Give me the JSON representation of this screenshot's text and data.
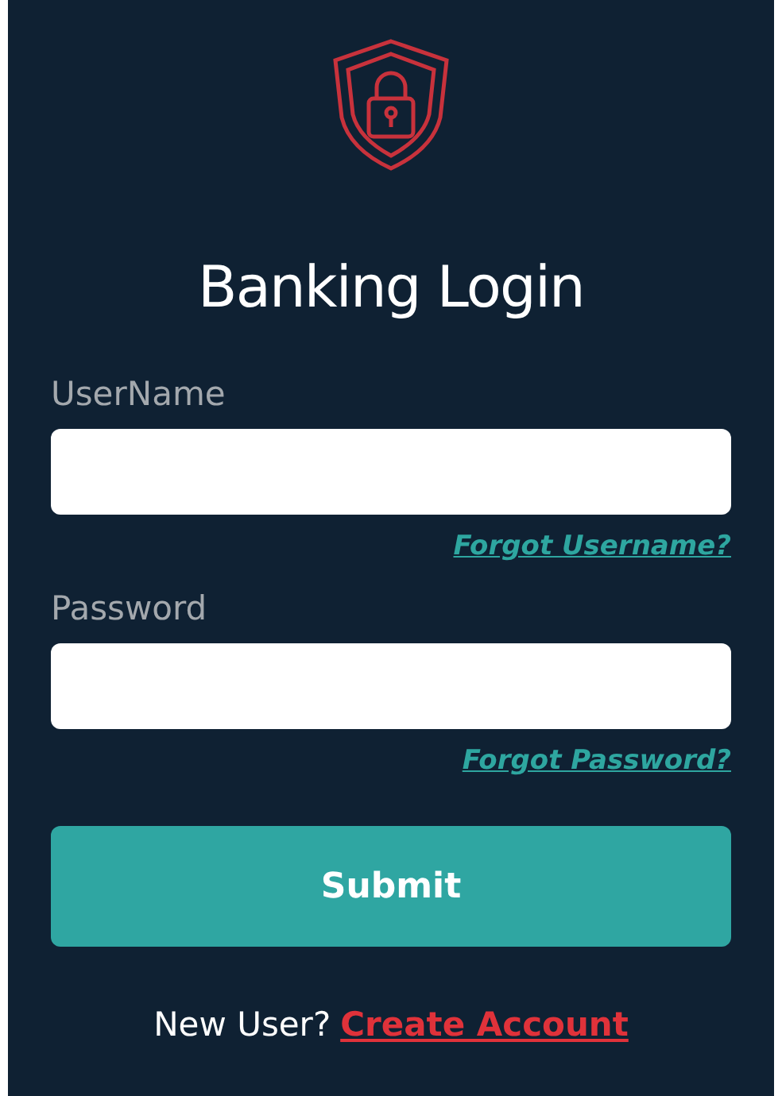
{
  "title": "Banking Login",
  "fields": [
    {
      "label": "UserName",
      "link": "Forgot Username?"
    },
    {
      "label": "Password",
      "link": "Forgot Password?"
    }
  ],
  "submit": "Submit",
  "footer": {
    "text": "New User?",
    "link": "Create Account"
  }
}
